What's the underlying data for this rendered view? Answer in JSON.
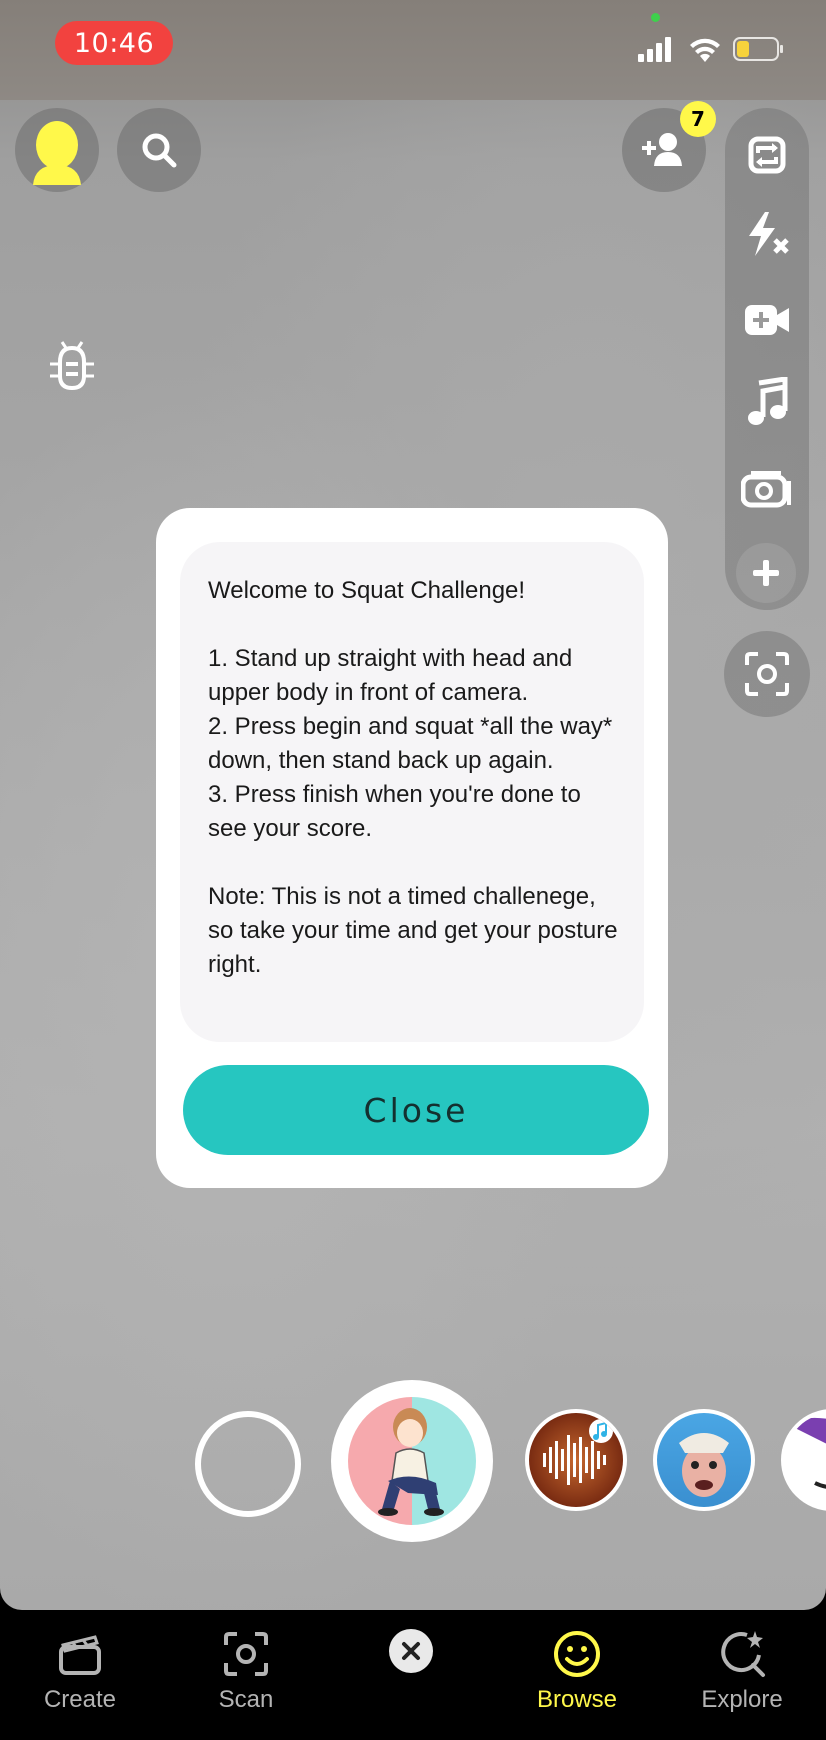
{
  "status_bar": {
    "time": "10:46"
  },
  "top": {
    "notification_count": "7"
  },
  "dialog": {
    "text": "Welcome to Squat Challenge!\n\n1. Stand up straight with head and upper body in front of camera.\n2. Press begin and squat *all the way* down, then stand back up again.\n3. Press finish when you're done to see your score.\n\nNote: This is not a timed challenege, so take your time and get your posture right.",
    "close_label": "Close"
  },
  "nav": {
    "items": [
      {
        "label": "Create",
        "icon": "clapperboard-icon",
        "active": false
      },
      {
        "label": "Scan",
        "icon": "scan-icon",
        "active": false
      },
      {
        "label": "Browse",
        "icon": "smiley-icon",
        "active": true
      },
      {
        "label": "Explore",
        "icon": "explore-star-icon",
        "active": false
      }
    ]
  },
  "colors": {
    "accent_teal": "#26c6c0",
    "active_yellow": "#fff84a",
    "time_pill": "#f2423f",
    "inactive_gray": "#b4b4b4"
  }
}
